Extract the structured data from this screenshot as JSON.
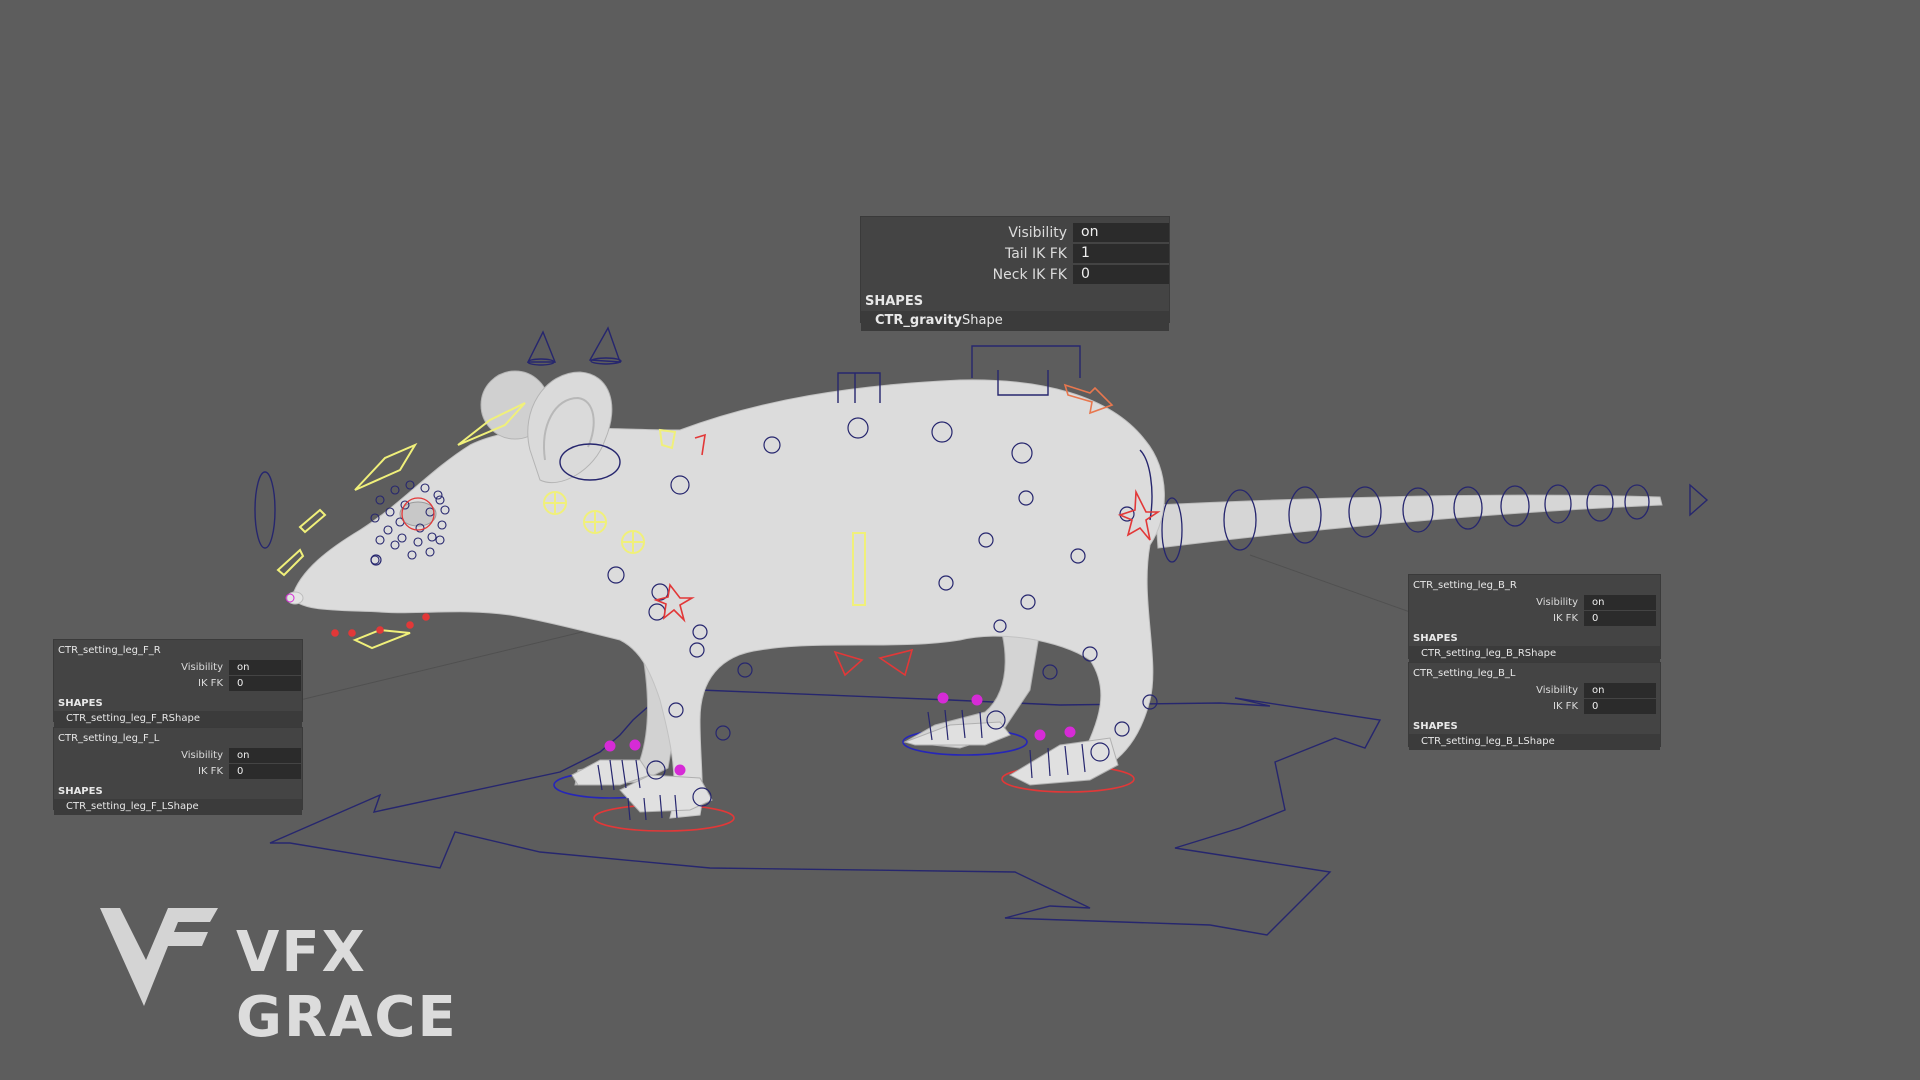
{
  "app": "Maya 3D viewport",
  "colors": {
    "background": "#5d5d5d",
    "body": "#dcdcdc",
    "control_blue": "#26266e",
    "control_yellow": "#f0f07a",
    "control_red": "#e23838",
    "control_magenta": "#d62bd6",
    "control_orange": "#e8774e"
  },
  "gravity_panel": {
    "rows": [
      {
        "label": "Visibility",
        "value": "on"
      },
      {
        "label": "Tail IK FK",
        "value": "1"
      },
      {
        "label": "Neck IK FK",
        "value": "0"
      }
    ],
    "section": "SHAPES",
    "shape_bold": "CTR_gravity",
    "shape_rest": "Shape"
  },
  "leg_panels": {
    "front_right": {
      "title": "CTR_setting_leg_F_R",
      "rows": [
        {
          "label": "Visibility",
          "value": "on"
        },
        {
          "label": "IK FK",
          "value": "0"
        }
      ],
      "section": "SHAPES",
      "shape": "CTR_setting_leg_F_RShape"
    },
    "front_left": {
      "title": "CTR_setting_leg_F_L",
      "rows": [
        {
          "label": "Visibility",
          "value": "on"
        },
        {
          "label": "IK FK",
          "value": "0"
        }
      ],
      "section": "SHAPES",
      "shape": "CTR_setting_leg_F_LShape"
    },
    "back_right": {
      "title": "CTR_setting_leg_B_R",
      "rows": [
        {
          "label": "Visibility",
          "value": "on"
        },
        {
          "label": "IK FK",
          "value": "0"
        }
      ],
      "section": "SHAPES",
      "shape": "CTR_setting_leg_B_RShape"
    },
    "back_left": {
      "title": "CTR_setting_leg_B_L",
      "rows": [
        {
          "label": "Visibility",
          "value": "on"
        },
        {
          "label": "IK FK",
          "value": "0"
        }
      ],
      "section": "SHAPES",
      "shape": "CTR_setting_leg_B_LShape"
    }
  },
  "watermark": {
    "text": "VFX GRACE",
    "icon": "vfx-grace-logo-icon"
  }
}
